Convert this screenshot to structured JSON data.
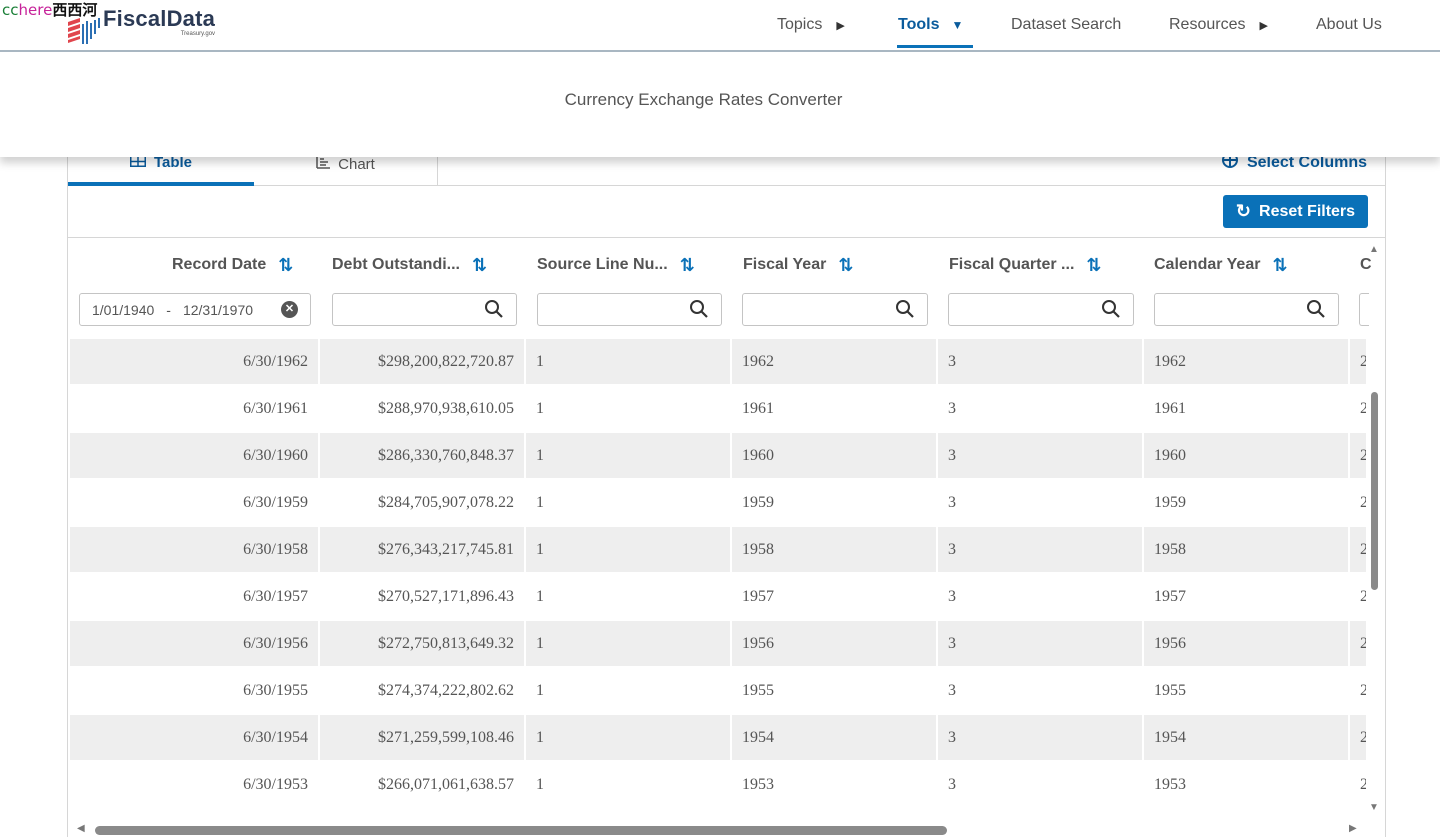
{
  "overlay": {
    "part1": "cc",
    "part2": "here",
    "part3": "西西河"
  },
  "logo": {
    "name": "FiscalData",
    "sub": "Treasury.gov"
  },
  "nav": {
    "topics": "Topics",
    "tools": "Tools",
    "dataset_search": "Dataset Search",
    "resources": "Resources",
    "about": "About Us"
  },
  "banner": {
    "title": "Currency Exchange Rates Converter"
  },
  "tabs": {
    "table": "Table",
    "chart": "Chart",
    "select_columns": "Select Columns"
  },
  "reset_filters": "Reset Filters",
  "date_filter": {
    "from": "1/01/1940",
    "separator": "-",
    "to": "12/31/1970"
  },
  "columns": [
    {
      "label": "Record Date"
    },
    {
      "label": "Debt Outstandi..."
    },
    {
      "label": "Source Line Nu..."
    },
    {
      "label": "Fiscal Year"
    },
    {
      "label": "Fiscal Quarter ..."
    },
    {
      "label": "Calendar Year"
    },
    {
      "label": "C"
    }
  ],
  "rows": [
    {
      "record_date": "6/30/1962",
      "debt": "$298,200,822,720.87",
      "source_line": "1",
      "fiscal_year": "1962",
      "fiscal_quarter": "3",
      "calendar_year": "1962",
      "next": "2"
    },
    {
      "record_date": "6/30/1961",
      "debt": "$288,970,938,610.05",
      "source_line": "1",
      "fiscal_year": "1961",
      "fiscal_quarter": "3",
      "calendar_year": "1961",
      "next": "2"
    },
    {
      "record_date": "6/30/1960",
      "debt": "$286,330,760,848.37",
      "source_line": "1",
      "fiscal_year": "1960",
      "fiscal_quarter": "3",
      "calendar_year": "1960",
      "next": "2"
    },
    {
      "record_date": "6/30/1959",
      "debt": "$284,705,907,078.22",
      "source_line": "1",
      "fiscal_year": "1959",
      "fiscal_quarter": "3",
      "calendar_year": "1959",
      "next": "2"
    },
    {
      "record_date": "6/30/1958",
      "debt": "$276,343,217,745.81",
      "source_line": "1",
      "fiscal_year": "1958",
      "fiscal_quarter": "3",
      "calendar_year": "1958",
      "next": "2"
    },
    {
      "record_date": "6/30/1957",
      "debt": "$270,527,171,896.43",
      "source_line": "1",
      "fiscal_year": "1957",
      "fiscal_quarter": "3",
      "calendar_year": "1957",
      "next": "2"
    },
    {
      "record_date": "6/30/1956",
      "debt": "$272,750,813,649.32",
      "source_line": "1",
      "fiscal_year": "1956",
      "fiscal_quarter": "3",
      "calendar_year": "1956",
      "next": "2"
    },
    {
      "record_date": "6/30/1955",
      "debt": "$274,374,222,802.62",
      "source_line": "1",
      "fiscal_year": "1955",
      "fiscal_quarter": "3",
      "calendar_year": "1955",
      "next": "2"
    },
    {
      "record_date": "6/30/1954",
      "debt": "$271,259,599,108.46",
      "source_line": "1",
      "fiscal_year": "1954",
      "fiscal_quarter": "3",
      "calendar_year": "1954",
      "next": "2"
    },
    {
      "record_date": "6/30/1953",
      "debt": "$266,071,061,638.57",
      "source_line": "1",
      "fiscal_year": "1953",
      "fiscal_quarter": "3",
      "calendar_year": "1953",
      "next": "2"
    }
  ],
  "colors": {
    "accent": "#0a71b8",
    "accent_dark": "#0a5b9c",
    "row_shade": "#eeeeee",
    "text": "#555555"
  }
}
